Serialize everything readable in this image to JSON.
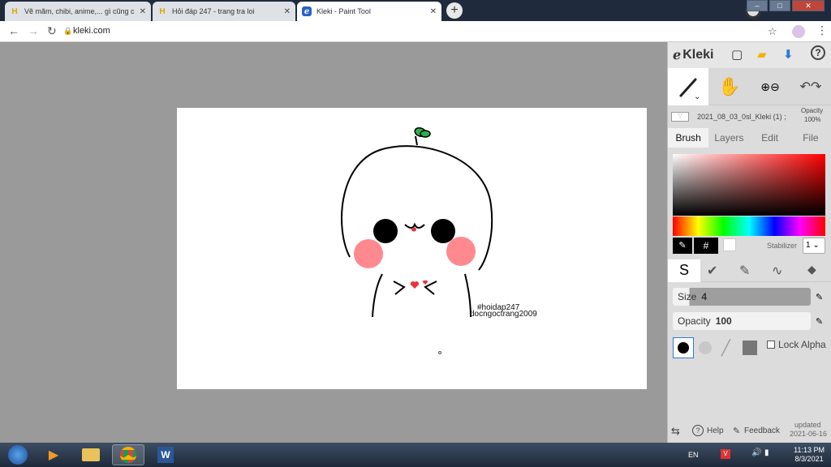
{
  "browser": {
    "tabs": [
      {
        "title": "Vẽ mãm, chibi, anime,... gì cũng c",
        "favicon": "hoidap-icon"
      },
      {
        "title": "Hỏi đáp 247 - trang tra loi",
        "favicon": "hoidap-icon"
      },
      {
        "title": "Kleki - Paint Tool",
        "favicon": "kleki-icon"
      }
    ],
    "new_tab": "+",
    "url": "kleki.com",
    "win": {
      "min": "–",
      "max": "□",
      "close": "✕"
    }
  },
  "canvas": {
    "watermark_line1": "#hoidap247",
    "watermark_line2": "docngoctrang2009"
  },
  "kleki": {
    "logo": "Kleki",
    "file_name": "2021_08_03_0sl_Kleki (1) ;",
    "opacity_label": "Opacity",
    "opacity_value": "100%",
    "tabs": [
      "Brush",
      "Layers",
      "Edit",
      "File"
    ],
    "hex_symbol": "#",
    "stabilizer_label": "Stabilizer",
    "stabilizer_value": "1",
    "size_label": "Size",
    "size_value": "4",
    "brush_opacity_label": "Opacity",
    "brush_opacity_value": "100",
    "lock_alpha": "Lock Alpha",
    "help": "Help",
    "feedback": "Feedback",
    "updated_label": "updated",
    "updated_date": "2021-06-16",
    "colors": {
      "picker_hue": "#ff0000",
      "accent": "#2a7ad4"
    }
  },
  "taskbar": {
    "lang": "EN",
    "time": "11:13 PM",
    "date": "8/3/2021"
  }
}
